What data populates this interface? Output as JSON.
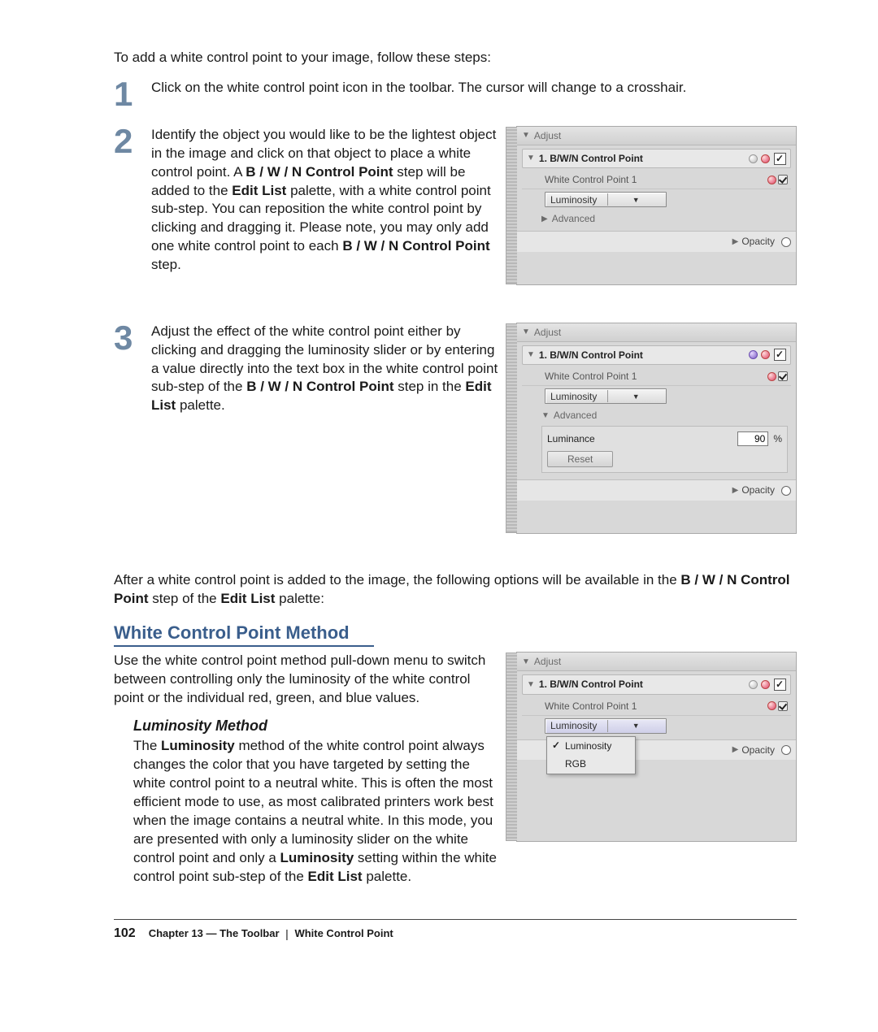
{
  "intro": "To add a white control point to your image, follow these steps:",
  "steps": {
    "1": {
      "num": "1",
      "text_a": "Click on the white control point icon in the toolbar. The cursor will change to a crosshair."
    },
    "2": {
      "num": "2",
      "text_pre": "Identify the object you would like to be the lightest object in the image and click on that object to place a white control point. A ",
      "bold_a": "B / W / N Control Point",
      "text_mid1": " step will be added to the ",
      "bold_b": "Edit List",
      "text_mid2": " palette, with a white control point sub-step. You can reposition the white control point by clicking and dragging it. Please note, you may only add one white control point to each ",
      "bold_c": "B / W / N Control Point",
      "text_post": " step."
    },
    "3": {
      "num": "3",
      "text_pre": "Adjust the effect of the white control point either by clicking and dragging the luminosity slider or by entering a value directly into the text box in the white control point sub-step of the ",
      "bold_a": "B / W / N Control Point",
      "text_mid1": " step in the ",
      "bold_b": "Edit List",
      "text_post": " palette."
    }
  },
  "after": {
    "pre": "After a white control point is added to the image, the following options will be available in the ",
    "bold_a": "B / W / N Control Point",
    "mid": " step of the ",
    "bold_b": "Edit List",
    "post": " palette:"
  },
  "section_head": "White Control Point Method",
  "method_para": "Use the white control point method pull-down menu to switch between controlling only the luminosity of the white control point or the individual red, green, and blue values.",
  "sub_head": "Luminosity Method",
  "lum": {
    "pre": "The ",
    "b1": "Luminosity",
    "t1": " method of the white control point always changes the color that you have targeted by setting the white control point to a neutral white. This is often the most efficient mode to use, as most calibrated printers work best when the image contains a neutral white. In this mode, you are presented with only a luminosity slider on the white control point and only a ",
    "b2": "Luminosity",
    "t2": " setting within the white control point sub-step of the ",
    "b3": "Edit List",
    "t3": " palette."
  },
  "panel": {
    "adjust": "Adjust",
    "step_label": "1. B/W/N Control Point",
    "substep": "White Control Point 1",
    "select_value": "Luminosity",
    "advanced": "Advanced",
    "luminance": "Luminance",
    "luminance_value": "90",
    "pct": "%",
    "reset": "Reset",
    "opacity": "Opacity",
    "dd_luminosity": "Luminosity",
    "dd_rgb": "RGB"
  },
  "footer": {
    "page": "102",
    "chapter": "Chapter 13 — The Toolbar",
    "sep": "|",
    "topic": "White Control Point"
  }
}
